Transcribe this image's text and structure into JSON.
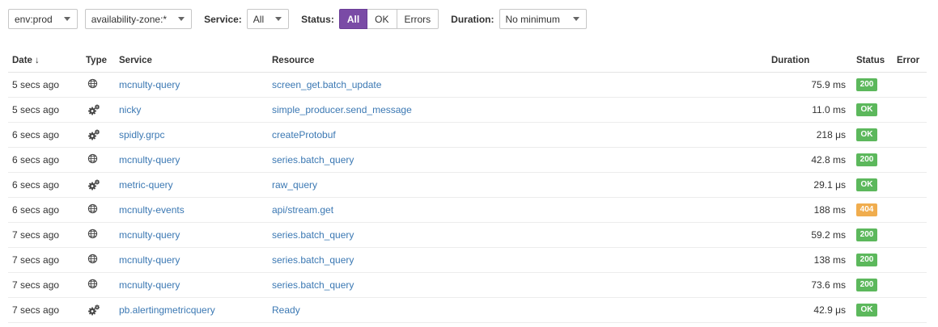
{
  "filters": {
    "env": "env:prod",
    "availability_zone": "availability-zone:*",
    "service_label": "Service:",
    "service_value": "All",
    "status_label": "Status:",
    "status_options": [
      "All",
      "OK",
      "Errors"
    ],
    "status_selected": "All",
    "duration_label": "Duration:",
    "duration_value": "No minimum"
  },
  "table": {
    "headers": {
      "date": "Date",
      "date_sort": "↓",
      "type": "Type",
      "service": "Service",
      "resource": "Resource",
      "duration": "Duration",
      "status": "Status",
      "error": "Error"
    },
    "rows": [
      {
        "date": "5 secs ago",
        "type": "web-icon",
        "service": "mcnulty-query",
        "resource": "screen_get.batch_update",
        "duration": "75.9 ms",
        "status": "200",
        "status_kind": "ok",
        "error": ""
      },
      {
        "date": "5 secs ago",
        "type": "gears-icon",
        "service": "nicky",
        "resource": "simple_producer.send_message",
        "duration": "11.0 ms",
        "status": "OK",
        "status_kind": "ok",
        "error": ""
      },
      {
        "date": "6 secs ago",
        "type": "gears-icon",
        "service": "spidly.grpc",
        "resource": "createProtobuf",
        "duration": "218 μs",
        "status": "OK",
        "status_kind": "ok",
        "error": ""
      },
      {
        "date": "6 secs ago",
        "type": "web-icon",
        "service": "mcnulty-query",
        "resource": "series.batch_query",
        "duration": "42.8 ms",
        "status": "200",
        "status_kind": "ok",
        "error": ""
      },
      {
        "date": "6 secs ago",
        "type": "gears-icon",
        "service": "metric-query",
        "resource": "raw_query",
        "duration": "29.1 μs",
        "status": "OK",
        "status_kind": "ok",
        "error": ""
      },
      {
        "date": "6 secs ago",
        "type": "web-icon",
        "service": "mcnulty-events",
        "resource": "api/stream.get",
        "duration": "188 ms",
        "status": "404",
        "status_kind": "warn",
        "error": ""
      },
      {
        "date": "7 secs ago",
        "type": "web-icon",
        "service": "mcnulty-query",
        "resource": "series.batch_query",
        "duration": "59.2 ms",
        "status": "200",
        "status_kind": "ok",
        "error": ""
      },
      {
        "date": "7 secs ago",
        "type": "web-icon",
        "service": "mcnulty-query",
        "resource": "series.batch_query",
        "duration": "138 ms",
        "status": "200",
        "status_kind": "ok",
        "error": ""
      },
      {
        "date": "7 secs ago",
        "type": "web-icon",
        "service": "mcnulty-query",
        "resource": "series.batch_query",
        "duration": "73.6 ms",
        "status": "200",
        "status_kind": "ok",
        "error": ""
      },
      {
        "date": "7 secs ago",
        "type": "gears-icon",
        "service": "pb.alertingmetricquery",
        "resource": "Ready",
        "duration": "42.9 μs",
        "status": "OK",
        "status_kind": "ok",
        "error": ""
      }
    ]
  },
  "colors": {
    "accent": "#7a4ba6",
    "link": "#3b78b3",
    "status_ok": "#5cb85c",
    "status_warn": "#f0ad4e"
  }
}
